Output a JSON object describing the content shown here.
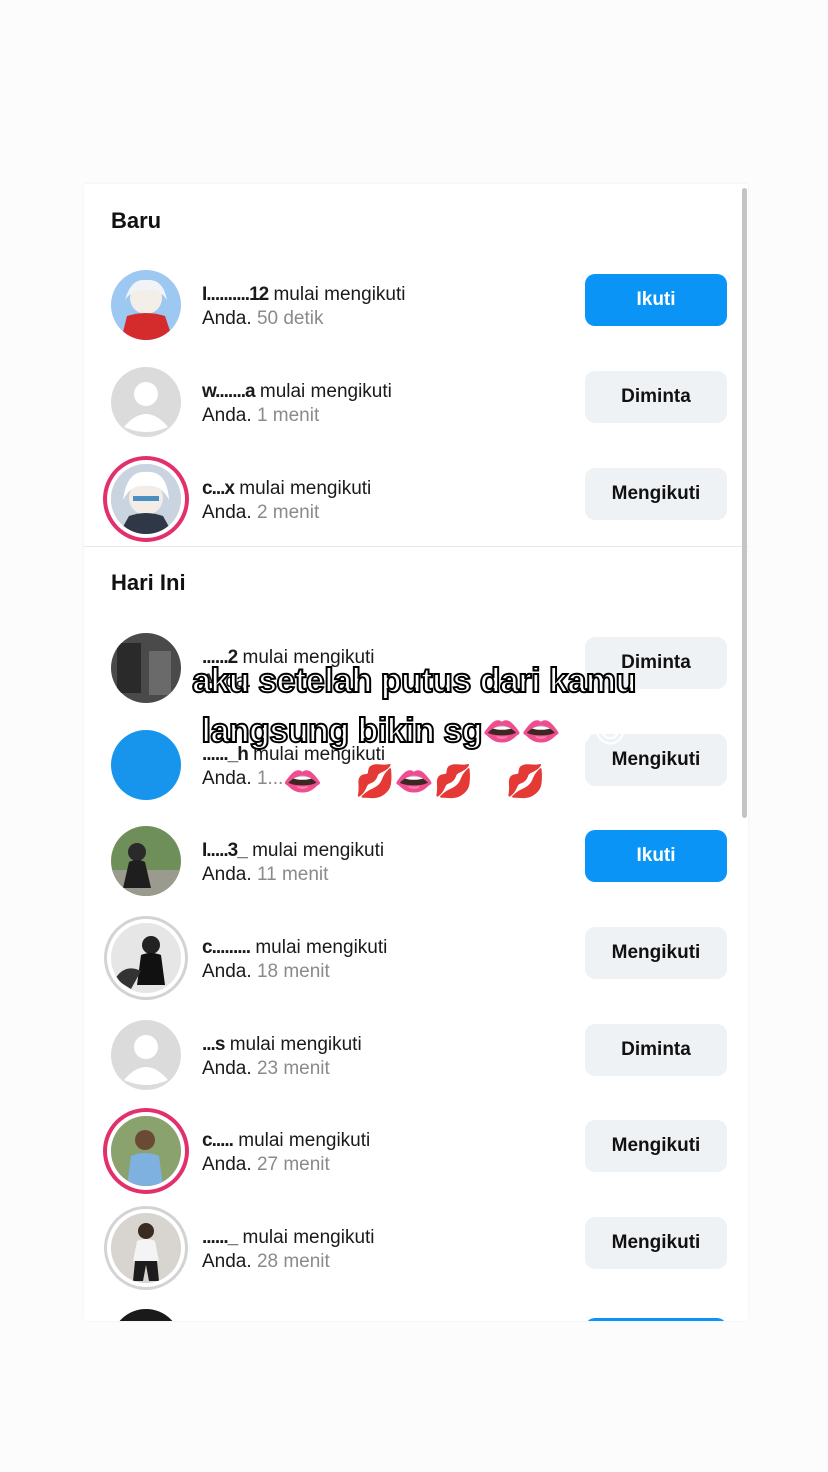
{
  "sections": [
    {
      "title": "Baru"
    },
    {
      "title": "Hari Ini"
    }
  ],
  "suffix": "mulai mengikuti",
  "you": "Anda.",
  "rows": [
    {
      "user": "I..........12",
      "time": "50 detik",
      "button": "Ikuti",
      "style": "blue",
      "avatar": "anime-avatar-red"
    },
    {
      "user": "w.......a",
      "time": "1 menit",
      "button": "Diminta",
      "style": "grey",
      "avatar": "default-avatar"
    },
    {
      "user": "c...x",
      "time": "2 menit",
      "button": "Mengikuti",
      "style": "grey",
      "avatar": "anime-avatar-white"
    },
    {
      "user": "......2",
      "time": "",
      "button": "Diminta",
      "style": "grey",
      "avatar": "photo-avatar-dark"
    },
    {
      "user": "......_h",
      "time": "1...",
      "button": "Mengikuti",
      "style": "grey",
      "avatar": "blue-circle-avatar"
    },
    {
      "user": "I.....3_",
      "time": "11 menit",
      "button": "Ikuti",
      "style": "blue",
      "avatar": "photo-avatar-green"
    },
    {
      "user": "c.........",
      "time": "18 menit",
      "button": "Mengikuti",
      "style": "grey",
      "avatar": "photo-avatar-bw"
    },
    {
      "user": "...s",
      "time": "23 menit",
      "button": "Diminta",
      "style": "grey",
      "avatar": "default-avatar"
    },
    {
      "user": "c.....",
      "time": "27 menit",
      "button": "Mengikuti",
      "style": "grey",
      "avatar": "photo-avatar-person"
    },
    {
      "user": "......_",
      "time": "28 menit",
      "button": "Mengikuti",
      "style": "grey",
      "avatar": "photo-avatar-street"
    }
  ],
  "overlay": {
    "line1": "aku setelah putus dari kamu",
    "line2": "langsung bikin sg",
    "line2_emoji": "👄👄😍😍",
    "line3_emoji": "👄😍💋👄💋😍💋"
  },
  "colors": {
    "primary": "#0a95f6",
    "secondary": "#eff2f5",
    "story_ring": "#e1306c"
  }
}
